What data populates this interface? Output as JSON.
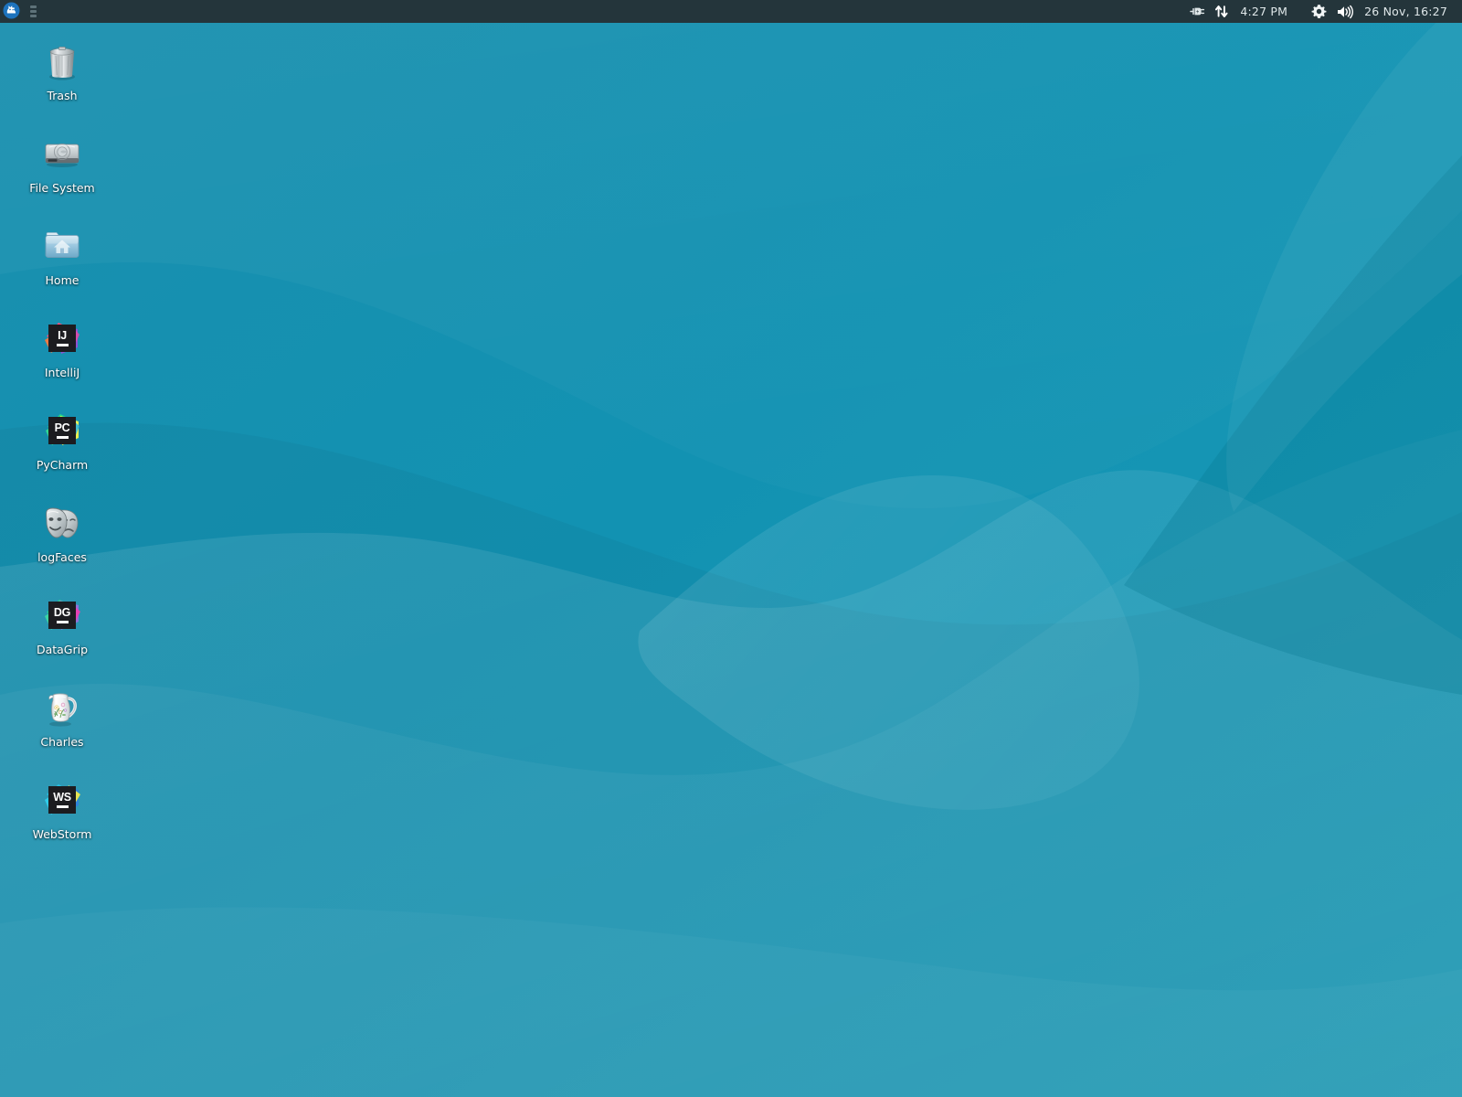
{
  "desktop": {
    "environment": "xfce",
    "wallpaper_colors": {
      "base_dark": "#0f87a6",
      "base_mid": "#1392b2",
      "base_light": "#1a9ab6",
      "wave_light": "#3db0cf",
      "wave_lighter": "#49bad6",
      "wave_shadow": "#0d86a4"
    }
  },
  "panel": {
    "background": "#24353b",
    "text_color": "#dfe7e9",
    "applications_menu": {
      "name": "applications-menu",
      "tooltip": "Applications"
    },
    "window_buttons": {
      "name": "window-buttons"
    },
    "tray": [
      {
        "name": "power-plug-icon",
        "label": ""
      },
      {
        "name": "network-icon",
        "label": ""
      }
    ],
    "clock_short": "4:27 PM",
    "settings_icon": "gear-icon",
    "volume_icon": "speaker-icon",
    "clock_long": "26 Nov, 16:27"
  },
  "icons": [
    {
      "label": "Trash",
      "type": "trash",
      "name": "desktop-icon-trash"
    },
    {
      "label": "File System",
      "type": "drive",
      "name": "desktop-icon-file-system"
    },
    {
      "label": "Home",
      "type": "home",
      "name": "desktop-icon-home"
    },
    {
      "label": "IntelliJ",
      "type": "jetbrains",
      "initials": "IJ",
      "name": "desktop-icon-intellij"
    },
    {
      "label": "PyCharm",
      "type": "jetbrains",
      "initials": "PC",
      "name": "desktop-icon-pycharm"
    },
    {
      "label": "logFaces",
      "type": "masks",
      "name": "desktop-icon-logfaces"
    },
    {
      "label": "DataGrip",
      "type": "jetbrains",
      "initials": "DG",
      "name": "desktop-icon-datagrip"
    },
    {
      "label": "Charles",
      "type": "pitcher",
      "name": "desktop-icon-charles"
    },
    {
      "label": "WebStorm",
      "type": "jetbrains",
      "initials": "WS",
      "name": "desktop-icon-webstorm"
    }
  ]
}
